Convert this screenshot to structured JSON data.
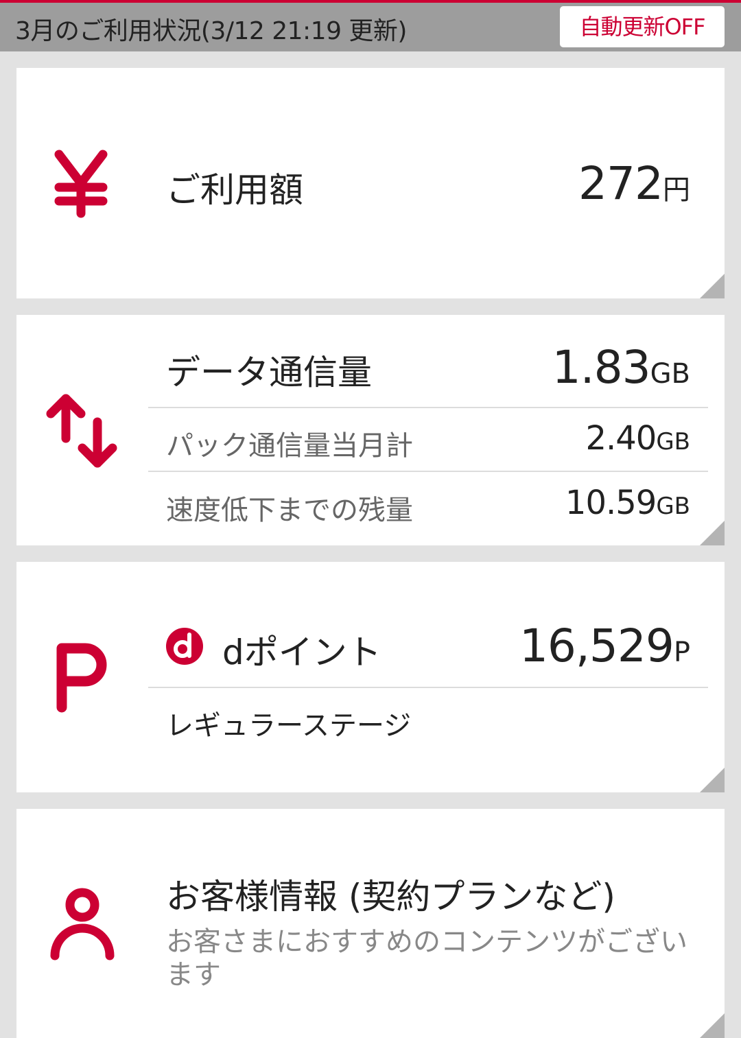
{
  "header": {
    "title": "3月のご利用状況(3/12 21:19 更新)",
    "auto_update_button": "自動更新OFF"
  },
  "colors": {
    "accent": "#cc0033",
    "header_bg": "#9d9d9d",
    "page_bg": "#e2e2e2"
  },
  "usage_card": {
    "icon": "yen-icon",
    "label": "ご利用額",
    "value": "272",
    "unit": "円"
  },
  "data_card": {
    "icon": "data-transfer-icon",
    "label": "データ通信量",
    "value": "1.83",
    "unit": "GB",
    "rows": [
      {
        "label": "パック通信量当月計",
        "value": "2.40",
        "unit": "GB"
      },
      {
        "label": "速度低下までの残量",
        "value": "10.59",
        "unit": "GB"
      }
    ]
  },
  "points_card": {
    "icon": "points-p-icon",
    "logo": "d-logo-icon",
    "label": "dポイント",
    "value": "16,529",
    "unit": "P",
    "stage": "レギュラーステージ"
  },
  "customer_card": {
    "icon": "user-icon",
    "label": "お客様情報 (契約プランなど)",
    "description": "お客さまにおすすめのコンテンツがございます"
  }
}
